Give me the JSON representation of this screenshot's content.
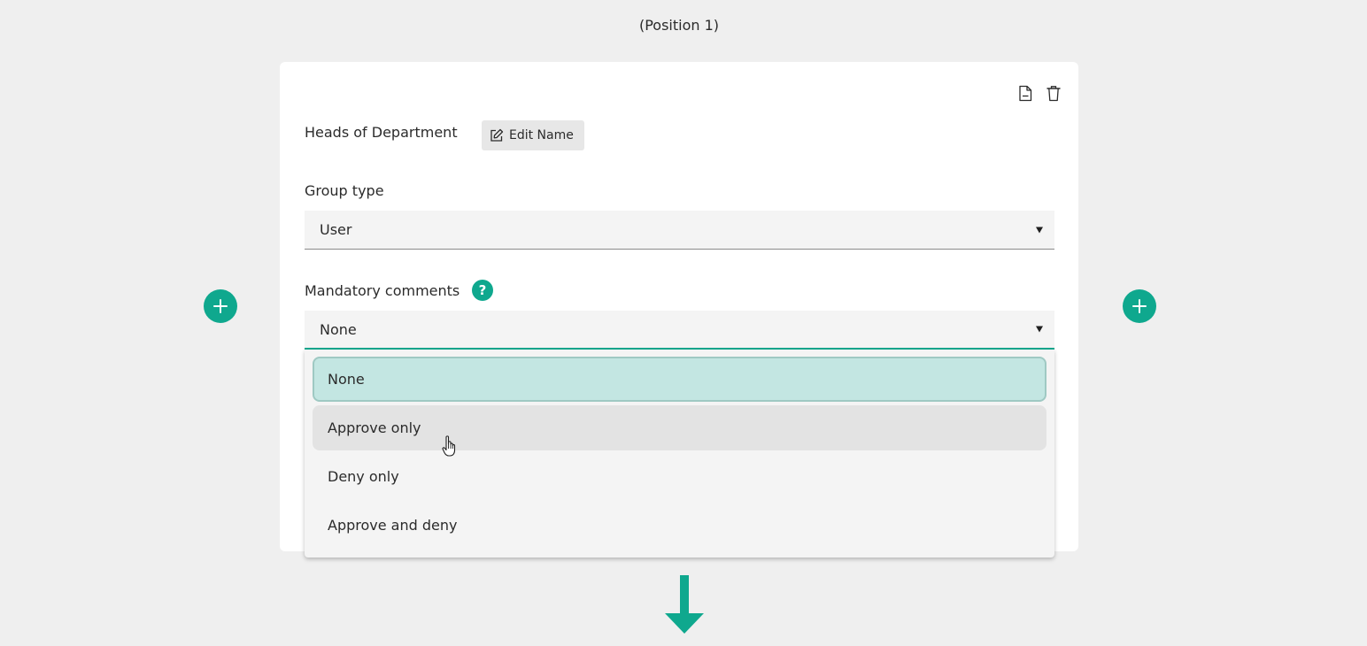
{
  "position_label": "(Position 1)",
  "card": {
    "group_name": "Heads of Department",
    "edit_name_label": "Edit Name",
    "actions": [
      "document-icon",
      "trash-icon"
    ]
  },
  "group_type": {
    "label": "Group type",
    "value": "User"
  },
  "mandatory_comments": {
    "label": "Mandatory comments",
    "help_glyph": "?",
    "value": "None",
    "options": [
      {
        "label": "None",
        "state": "selected"
      },
      {
        "label": "Approve only",
        "state": "hovered"
      },
      {
        "label": "Deny only",
        "state": "normal"
      },
      {
        "label": "Approve and deny",
        "state": "normal"
      }
    ]
  },
  "colors": {
    "accent": "#0fa88e",
    "selected_option_bg": "#c3e6e2",
    "hover_option_bg": "#e3e3e3",
    "page_bg": "#efefef"
  }
}
